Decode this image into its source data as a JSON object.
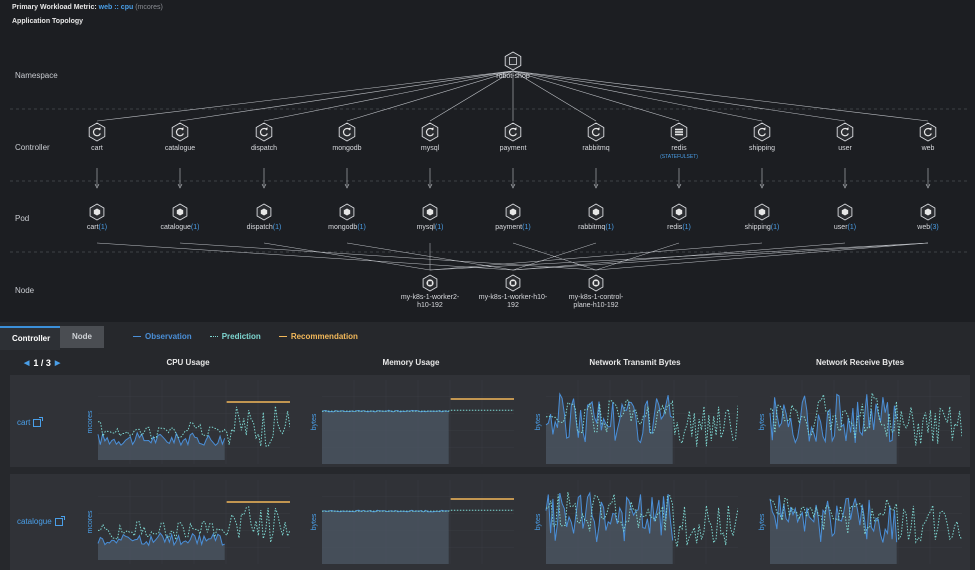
{
  "header": {
    "primary_label": "Primary Workload Metric:",
    "metric": "web :: cpu",
    "unit": "(mcores)",
    "subtitle": "Application Topology"
  },
  "topology": {
    "row_labels": [
      "Namespace",
      "Controller",
      "Pod",
      "Node"
    ],
    "namespace": "robot-shop",
    "controllers": [
      {
        "name": "cart"
      },
      {
        "name": "catalogue"
      },
      {
        "name": "dispatch"
      },
      {
        "name": "mongodb"
      },
      {
        "name": "mysql"
      },
      {
        "name": "payment"
      },
      {
        "name": "rabbitmq"
      },
      {
        "name": "redis",
        "sub": "(STATEFULSET)"
      },
      {
        "name": "shipping"
      },
      {
        "name": "user"
      },
      {
        "name": "web"
      }
    ],
    "pods": [
      {
        "name": "cart",
        "count": "(1)"
      },
      {
        "name": "catalogue",
        "count": "(1)"
      },
      {
        "name": "dispatch",
        "count": "(1)"
      },
      {
        "name": "mongodb",
        "count": "(1)"
      },
      {
        "name": "mysql",
        "count": "(1)"
      },
      {
        "name": "payment",
        "count": "(1)"
      },
      {
        "name": "rabbitmq",
        "count": "(1)"
      },
      {
        "name": "redis",
        "count": "(1)"
      },
      {
        "name": "shipping",
        "count": "(1)"
      },
      {
        "name": "user",
        "count": "(1)"
      },
      {
        "name": "web",
        "count": "(3)"
      }
    ],
    "nodes": [
      {
        "line1": "my-k8s-1-worker2-",
        "line2": "h10-192"
      },
      {
        "line1": "my-k8s-1-worker-h10-",
        "line2": "192"
      },
      {
        "line1": "my-k8s-1-control-",
        "line2": "plane-h10-192"
      }
    ]
  },
  "tabs": [
    {
      "label": "Controller",
      "active": true
    },
    {
      "label": "Node",
      "active": false
    }
  ],
  "legend": {
    "observation": "Observation",
    "prediction": "Prediction",
    "recommendation": "Recommendation"
  },
  "pager": {
    "text": "1 / 3"
  },
  "columns": [
    "CPU Usage",
    "Memory Usage",
    "Network Transmit Bytes",
    "Network Receive Bytes"
  ],
  "y_units": [
    "mcores",
    "bytes",
    "bytes",
    "bytes"
  ],
  "rows": [
    {
      "name": "cart"
    },
    {
      "name": "catalogue"
    }
  ],
  "colors": {
    "background": "#1c1e22",
    "observation": "#4a8fd8",
    "prediction": "#7ed8d2",
    "recommendation": "#f2b85a",
    "link": "#4a9fe8"
  }
}
